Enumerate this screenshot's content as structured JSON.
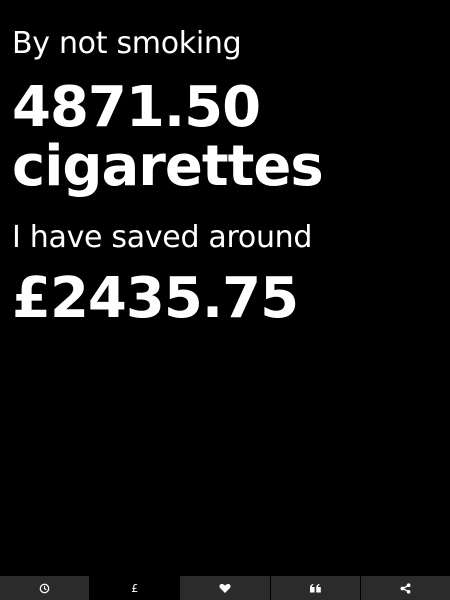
{
  "stats": {
    "intro": "By not smoking",
    "cigarettes_count": "4871.50",
    "cigarettes_unit": "cigarettes",
    "saved_label": "I have saved around",
    "saved_amount": "£2435.75"
  },
  "tabbar": {
    "active_index": 1,
    "tabs": [
      {
        "icon": "clock-icon"
      },
      {
        "icon": "pound-icon",
        "glyph": "£"
      },
      {
        "icon": "heart-icon"
      },
      {
        "icon": "quote-icon"
      },
      {
        "icon": "share-icon"
      }
    ]
  },
  "colors": {
    "background": "#000000",
    "text": "#ffffff",
    "tab_inactive": "#2b2b2b",
    "tab_active": "#000000"
  }
}
